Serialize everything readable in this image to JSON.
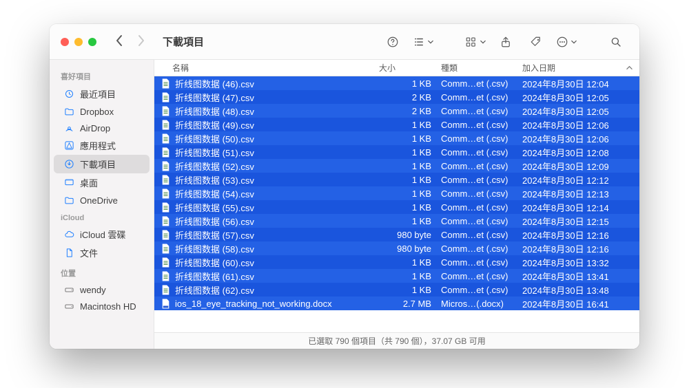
{
  "window": {
    "title": "下載項目"
  },
  "columns": {
    "name": "名稱",
    "size": "大小",
    "kind": "種類",
    "date": "加入日期"
  },
  "sidebar": {
    "sections": [
      {
        "label": "喜好項目",
        "items": [
          {
            "icon": "clock",
            "label": "最近項目"
          },
          {
            "icon": "folder",
            "label": "Dropbox"
          },
          {
            "icon": "airdrop",
            "label": "AirDrop"
          },
          {
            "icon": "apps",
            "label": "應用程式"
          },
          {
            "icon": "download",
            "label": "下載項目",
            "active": true
          },
          {
            "icon": "desktop",
            "label": "桌面"
          },
          {
            "icon": "folder",
            "label": "OneDrive"
          }
        ]
      },
      {
        "label": "iCloud",
        "items": [
          {
            "icon": "cloud",
            "label": "iCloud 雲碟"
          },
          {
            "icon": "doc",
            "label": "文件"
          }
        ]
      },
      {
        "label": "位置",
        "items": [
          {
            "icon": "disk",
            "label": "wendy",
            "gray": true
          },
          {
            "icon": "disk",
            "label": "Macintosh HD",
            "gray": true
          }
        ]
      }
    ]
  },
  "files": [
    {
      "name": "折线图数据 (46).csv",
      "size": "1 KB",
      "kind": "Comm…et (.csv)",
      "date": "2024年8月30日 12:04",
      "type": "csv"
    },
    {
      "name": "折线图数据 (47).csv",
      "size": "2 KB",
      "kind": "Comm…et (.csv)",
      "date": "2024年8月30日 12:05",
      "type": "csv"
    },
    {
      "name": "折线图数据 (48).csv",
      "size": "2 KB",
      "kind": "Comm…et (.csv)",
      "date": "2024年8月30日 12:05",
      "type": "csv"
    },
    {
      "name": "折线图数据 (49).csv",
      "size": "1 KB",
      "kind": "Comm…et (.csv)",
      "date": "2024年8月30日 12:06",
      "type": "csv"
    },
    {
      "name": "折线图数据 (50).csv",
      "size": "1 KB",
      "kind": "Comm…et (.csv)",
      "date": "2024年8月30日 12:06",
      "type": "csv"
    },
    {
      "name": "折线图数据 (51).csv",
      "size": "1 KB",
      "kind": "Comm…et (.csv)",
      "date": "2024年8月30日 12:08",
      "type": "csv"
    },
    {
      "name": "折线图数据 (52).csv",
      "size": "1 KB",
      "kind": "Comm…et (.csv)",
      "date": "2024年8月30日 12:09",
      "type": "csv"
    },
    {
      "name": "折线图数据 (53).csv",
      "size": "1 KB",
      "kind": "Comm…et (.csv)",
      "date": "2024年8月30日 12:12",
      "type": "csv"
    },
    {
      "name": "折线图数据 (54).csv",
      "size": "1 KB",
      "kind": "Comm…et (.csv)",
      "date": "2024年8月30日 12:13",
      "type": "csv"
    },
    {
      "name": "折线图数据 (55).csv",
      "size": "1 KB",
      "kind": "Comm…et (.csv)",
      "date": "2024年8月30日 12:14",
      "type": "csv"
    },
    {
      "name": "折线图数据 (56).csv",
      "size": "1 KB",
      "kind": "Comm…et (.csv)",
      "date": "2024年8月30日 12:15",
      "type": "csv"
    },
    {
      "name": "折线图数据 (57).csv",
      "size": "980 byte",
      "kind": "Comm…et (.csv)",
      "date": "2024年8月30日 12:16",
      "type": "csv"
    },
    {
      "name": "折线图数据 (58).csv",
      "size": "980 byte",
      "kind": "Comm…et (.csv)",
      "date": "2024年8月30日 12:16",
      "type": "csv"
    },
    {
      "name": "折线图数据 (60).csv",
      "size": "1 KB",
      "kind": "Comm…et (.csv)",
      "date": "2024年8月30日 13:32",
      "type": "csv"
    },
    {
      "name": "折线图数据 (61).csv",
      "size": "1 KB",
      "kind": "Comm…et (.csv)",
      "date": "2024年8月30日 13:41",
      "type": "csv"
    },
    {
      "name": "折线图数据 (62).csv",
      "size": "1 KB",
      "kind": "Comm…et (.csv)",
      "date": "2024年8月30日 13:48",
      "type": "csv"
    },
    {
      "name": "ios_18_eye_tracking_not_working.docx",
      "size": "2.7 MB",
      "kind": "Micros…(.docx)",
      "date": "2024年8月30日 16:41",
      "type": "docx"
    }
  ],
  "status": "已選取 790 個項目（共 790 個），37.07 GB 可用"
}
